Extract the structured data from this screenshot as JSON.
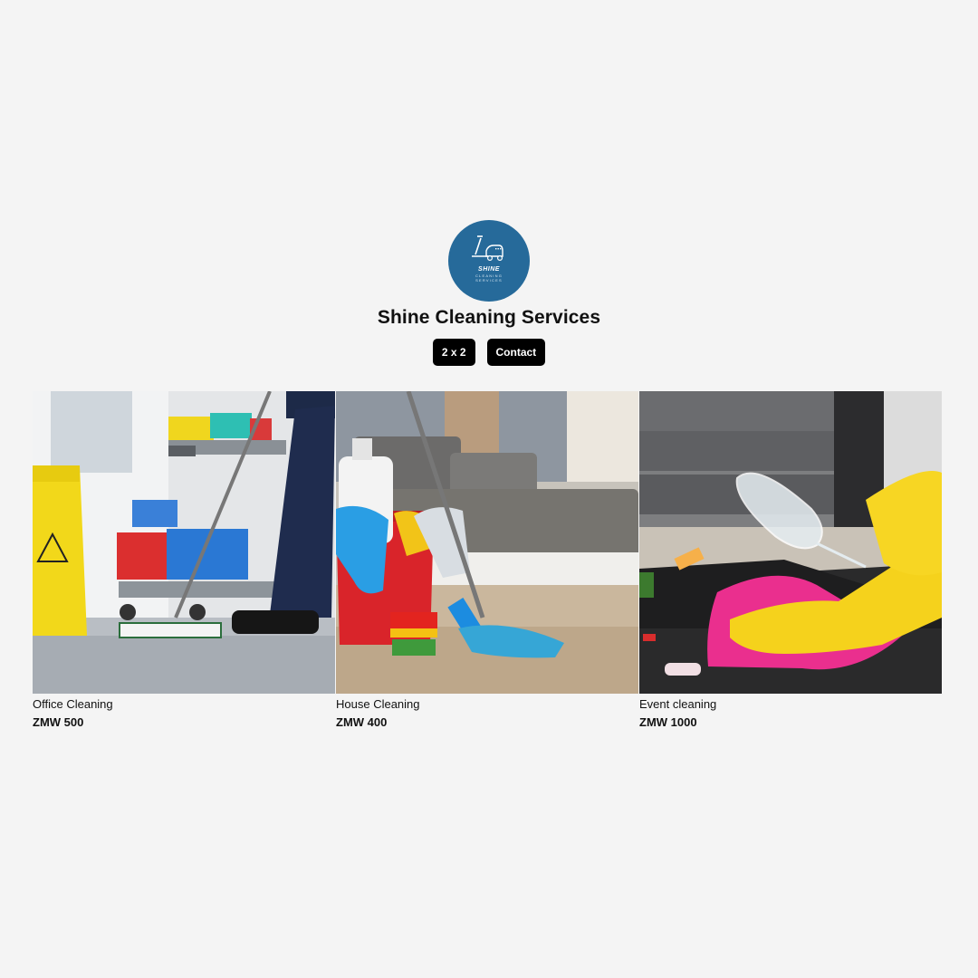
{
  "shop": {
    "logo_text": [
      "SHINE",
      "CLEANING",
      "SERVICES"
    ],
    "title": "Shine Cleaning Services",
    "brand_color": "#266a9a"
  },
  "nav": {
    "layout_button": "2 x 2",
    "contact_button": "Contact"
  },
  "services": [
    {
      "name": "Office Cleaning",
      "price": "ZMW 500",
      "image": "office-cleaning-photo"
    },
    {
      "name": "House Cleaning",
      "price": "ZMW 400",
      "image": "house-cleaning-photo"
    },
    {
      "name": "Event cleaning",
      "price": "ZMW 1000",
      "image": "event-cleaning-photo"
    }
  ]
}
